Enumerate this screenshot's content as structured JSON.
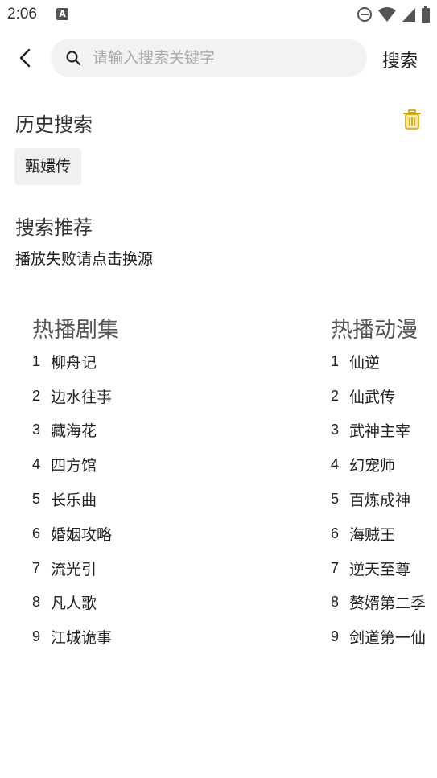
{
  "status_bar": {
    "time": "2:06",
    "notification_icon": "A",
    "icons": [
      "do-not-disturb-icon",
      "wifi-icon",
      "signal-icon",
      "battery-icon"
    ]
  },
  "header": {
    "search_placeholder": "请输入搜索关键字",
    "search_value": "",
    "search_button_label": "搜索"
  },
  "history": {
    "title": "历史搜索",
    "items": [
      "甄嬛传"
    ]
  },
  "recommend": {
    "title": "搜索推荐",
    "note": "播放失败请点击换源"
  },
  "hot_lists": [
    {
      "title": "热播剧集",
      "items": [
        {
          "rank": "1",
          "name": "柳舟记"
        },
        {
          "rank": "2",
          "name": "边水往事"
        },
        {
          "rank": "3",
          "name": "藏海花"
        },
        {
          "rank": "4",
          "name": "四方馆"
        },
        {
          "rank": "5",
          "name": "长乐曲"
        },
        {
          "rank": "6",
          "name": "婚姻攻略"
        },
        {
          "rank": "7",
          "name": "流光引"
        },
        {
          "rank": "8",
          "name": "凡人歌"
        },
        {
          "rank": "9",
          "name": "江城诡事"
        }
      ]
    },
    {
      "title": "热播动漫",
      "items": [
        {
          "rank": "1",
          "name": "仙逆"
        },
        {
          "rank": "2",
          "name": "仙武传"
        },
        {
          "rank": "3",
          "name": "武神主宰"
        },
        {
          "rank": "4",
          "name": "幻宠师"
        },
        {
          "rank": "5",
          "name": "百炼成神"
        },
        {
          "rank": "6",
          "name": "海贼王"
        },
        {
          "rank": "7",
          "name": "逆天至尊"
        },
        {
          "rank": "8",
          "name": "赘婿第二季"
        },
        {
          "rank": "9",
          "name": "剑道第一仙"
        }
      ]
    }
  ],
  "colors": {
    "trash_icon": "#c9a300",
    "search_box_bg": "#f2f2f2",
    "tag_bg": "#f0f0f0"
  }
}
